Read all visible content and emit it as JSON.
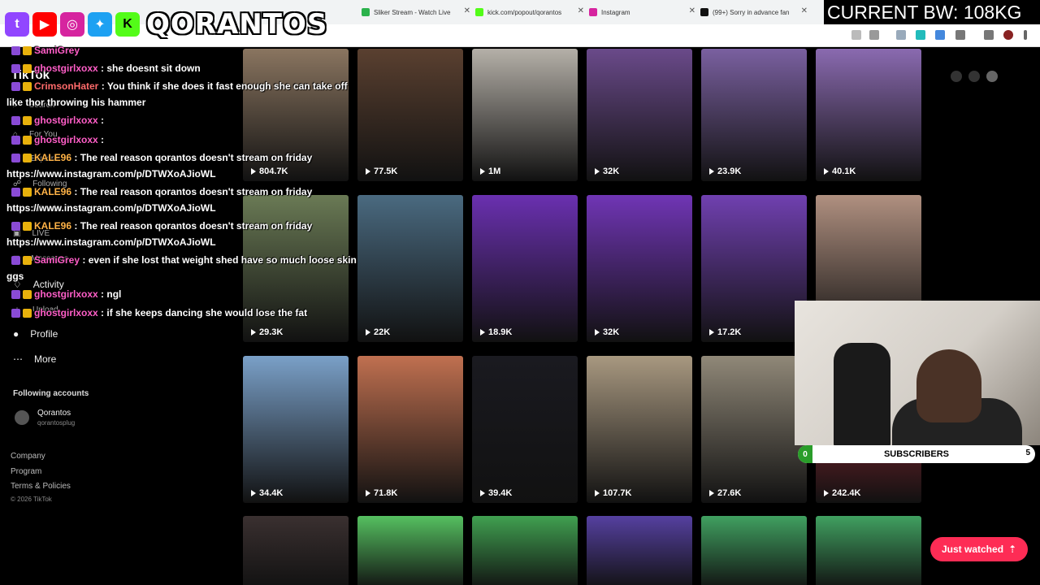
{
  "browser": {
    "tabs": [
      {
        "label": "Sliker Stream - Watch Live",
        "color": "#2bb24c"
      },
      {
        "label": "kick.com/popout/qorantos",
        "color": "#53fc18"
      },
      {
        "label": "Instagram",
        "color": "#d6249f"
      },
      {
        "label": "(99+) Sorry in advance fan",
        "color": "#111111"
      }
    ]
  },
  "overlay": {
    "brand": "QORANTOS",
    "bandwidth": "CURRENT BW: 108KG",
    "subscribers_label": "SUBSCRIBERS",
    "subscribers_left": "0",
    "subscribers_right": "5"
  },
  "sidebar": {
    "logo": "TikTok",
    "nav": [
      {
        "label": "Search"
      },
      {
        "label": "For You"
      },
      {
        "label": "Explore"
      },
      {
        "label": "Following"
      },
      {
        "label": "Friends"
      },
      {
        "label": "LIVE"
      },
      {
        "label": "Messages"
      },
      {
        "label": "Activity"
      },
      {
        "label": "Upload"
      },
      {
        "label": "Profile"
      },
      {
        "label": "More"
      }
    ],
    "following_header": "Following accounts",
    "account_name": "Qorantos",
    "account_handle": "qorantosplug",
    "footer": [
      "Company",
      "Program",
      "Terms & Policies",
      "© 2026 TikTok"
    ]
  },
  "chat": [
    {
      "user": "SamiGrey",
      "msg": "",
      "color": "pink"
    },
    {
      "user": "ghostgirlxoxx",
      "msg": ": she doesnt sit down",
      "color": "pink"
    },
    {
      "user": "CrimsonHater",
      "msg": ": You think if she does it fast enough she can take off",
      "color": "red"
    },
    {
      "user": "",
      "msg": "like thor throwing his hammer",
      "color": ""
    },
    {
      "user": "ghostgirlxoxx",
      "msg": ":",
      "color": "pink"
    },
    {
      "user": "ghostgirlxoxx",
      "msg": ":",
      "color": "pink"
    },
    {
      "user": "KALE96",
      "msg": ": The real reason qorantos doesn't stream on friday",
      "color": "orange"
    },
    {
      "user": "",
      "msg": "https://www.instagram.com/p/DTWXoAJioWL",
      "color": ""
    },
    {
      "user": "KALE96",
      "msg": ": The real reason qorantos doesn't stream on friday",
      "color": "orange"
    },
    {
      "user": "",
      "msg": "https://www.instagram.com/p/DTWXoAJioWL",
      "color": ""
    },
    {
      "user": "KALE96",
      "msg": ": The real reason qorantos doesn't stream on friday",
      "color": "orange"
    },
    {
      "user": "",
      "msg": "https://www.instagram.com/p/DTWXoAJioWL",
      "color": ""
    },
    {
      "user": "SamiGrey",
      "msg": ": even if she lost that weight shed have so much loose skin",
      "color": "pink"
    },
    {
      "user": "",
      "msg": "ggs",
      "color": ""
    },
    {
      "user": "ghostgirlxoxx",
      "msg": ": ngl",
      "color": "pink"
    },
    {
      "user": "ghostgirlxoxx",
      "msg": ": if she keeps dancing she would lose the fat",
      "color": "pink"
    }
  ],
  "videos": [
    {
      "views": "804.7K",
      "bg": "#8a7560"
    },
    {
      "views": "77.5K",
      "bg": "#5a4030"
    },
    {
      "views": "1M",
      "bg": "#b5b0a8"
    },
    {
      "views": "32K",
      "bg": "#6a4a8a"
    },
    {
      "views": "23.9K",
      "bg": "#7a60a0"
    },
    {
      "views": "40.1K",
      "bg": "#8a6ab0"
    },
    {
      "views": "29.3K",
      "bg": "#6a7a55"
    },
    {
      "views": "22K",
      "bg": "#4a6a80"
    },
    {
      "views": "18.9K",
      "bg": "#6a30b0"
    },
    {
      "views": "32K",
      "bg": "#7035b5"
    },
    {
      "views": "17.2K",
      "bg": "#7040b0"
    },
    {
      "views": "",
      "bg": "#b09080"
    },
    {
      "views": "34.4K",
      "bg": "#7aa0c8"
    },
    {
      "views": "71.8K",
      "bg": "#c07050"
    },
    {
      "views": "39.4K",
      "bg": "#1a1a20"
    },
    {
      "views": "107.7K",
      "bg": "#a89880"
    },
    {
      "views": "27.6K",
      "bg": "#908878"
    },
    {
      "views": "242.4K",
      "bg": "#c03040"
    },
    {
      "views": "",
      "bg": "#3a3030"
    },
    {
      "views": "",
      "bg": "#55c060"
    },
    {
      "views": "",
      "bg": "#40a050"
    },
    {
      "views": "",
      "bg": "#5540a0"
    },
    {
      "views": "",
      "bg": "#40a060"
    },
    {
      "views": "",
      "bg": "#40a060"
    }
  ],
  "just_watched": "Just watched"
}
